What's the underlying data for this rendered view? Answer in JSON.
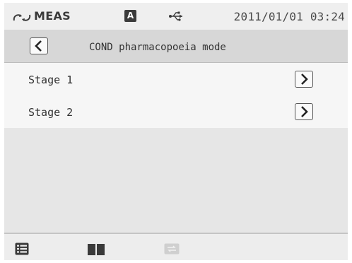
{
  "status": {
    "mode_label": "MEAS",
    "auto_badge": "A",
    "datetime": "2011/01/01 03:24"
  },
  "header": {
    "title": "COND pharmacopoeia mode"
  },
  "list": {
    "items": [
      {
        "label": "Stage 1"
      },
      {
        "label": "Stage 2"
      }
    ]
  },
  "icons": {
    "status": [
      "measure-icon",
      "usb-icon"
    ],
    "navigation": [
      "back-arrow-icon",
      "forward-arrow-icon"
    ],
    "bottom": [
      "menu-list-icon",
      "book-icon",
      "data-transfer-icon"
    ]
  },
  "colors": {
    "title_bar": "#d7d7d7",
    "list_row": "#f6f6f6",
    "empty_area": "#e6e6e6",
    "badge": "#3b3b3b",
    "disabled_icon": "#c9c9c9"
  }
}
